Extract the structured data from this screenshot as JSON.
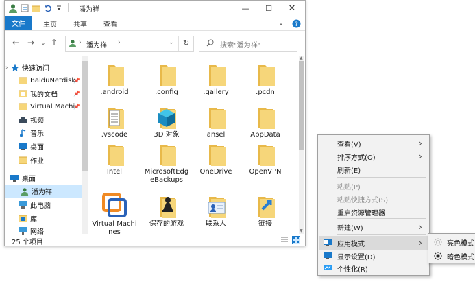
{
  "window": {
    "title": "潘为祥",
    "tabs": [
      "文件",
      "主页",
      "共享",
      "查看"
    ],
    "address_segment": "潘为祥",
    "search_placeholder": "搜索\"潘为祥\"",
    "status_count": "25 个项目"
  },
  "nav": {
    "items": [
      {
        "label": "快速访问",
        "icon": "star-icon"
      },
      {
        "label": "BaiduNetdisk",
        "icon": "folder-icon",
        "pinned": true
      },
      {
        "label": "我的文档",
        "icon": "documents-icon",
        "pinned": true
      },
      {
        "label": "Virtual Machi",
        "icon": "folder-icon",
        "pinned": true
      },
      {
        "label": "视频",
        "icon": "video-icon"
      },
      {
        "label": "音乐",
        "icon": "music-icon"
      },
      {
        "label": "桌面",
        "icon": "desktop-icon"
      },
      {
        "label": "作业",
        "icon": "folder-icon"
      },
      {
        "label": "桌面",
        "icon": "desktop-icon"
      },
      {
        "label": "潘为祥",
        "icon": "user-icon",
        "selected": true
      },
      {
        "label": "此电脑",
        "icon": "computer-icon"
      },
      {
        "label": "库",
        "icon": "library-icon"
      },
      {
        "label": "网络",
        "icon": "network-icon"
      }
    ]
  },
  "files": [
    {
      "name": ".android",
      "icon": "folder"
    },
    {
      "name": ".config",
      "icon": "folder"
    },
    {
      "name": ".gallery",
      "icon": "folder"
    },
    {
      "name": ".pcdn",
      "icon": "folder"
    },
    {
      "name": ".vscode",
      "icon": "document-folder"
    },
    {
      "name": "3D 对象",
      "icon": "3d-folder"
    },
    {
      "name": "ansel",
      "icon": "folder"
    },
    {
      "name": "AppData",
      "icon": "folder"
    },
    {
      "name": "Intel",
      "icon": "folder"
    },
    {
      "name": "MicrosoftEdgeBackups",
      "icon": "folder"
    },
    {
      "name": "OneDrive",
      "icon": "folder"
    },
    {
      "name": "OpenVPN",
      "icon": "folder"
    },
    {
      "name": "Virtual Machines",
      "icon": "vmware"
    },
    {
      "name": "保存的游戏",
      "icon": "games-folder"
    },
    {
      "name": "联系人",
      "icon": "contacts-folder"
    },
    {
      "name": "链接",
      "icon": "links-folder"
    }
  ],
  "context_menu": {
    "items": [
      {
        "label": "查看(V)",
        "submenu": true
      },
      {
        "label": "排序方式(O)",
        "submenu": true
      },
      {
        "label": "刷新(E)"
      },
      {
        "label": "粘贴(P)",
        "disabled": true
      },
      {
        "label": "粘贴快捷方式(S)",
        "disabled": true
      },
      {
        "label": "重启资源管理器"
      },
      {
        "label": "新建(W)",
        "submenu": true
      },
      {
        "label": "应用模式",
        "submenu": true,
        "highlighted": true,
        "icon": "app-mode-icon"
      },
      {
        "label": "显示设置(D)",
        "icon": "display-icon"
      },
      {
        "label": "个性化(R)",
        "icon": "personalize-icon"
      }
    ],
    "submenu": [
      {
        "label": "亮色模式",
        "icon": "sun-light-icon"
      },
      {
        "label": "暗色模式",
        "icon": "sun-dark-icon"
      }
    ]
  },
  "colors": {
    "accent": "#1979ca",
    "folder": "#f6d67a",
    "selection": "#cce8ff"
  }
}
